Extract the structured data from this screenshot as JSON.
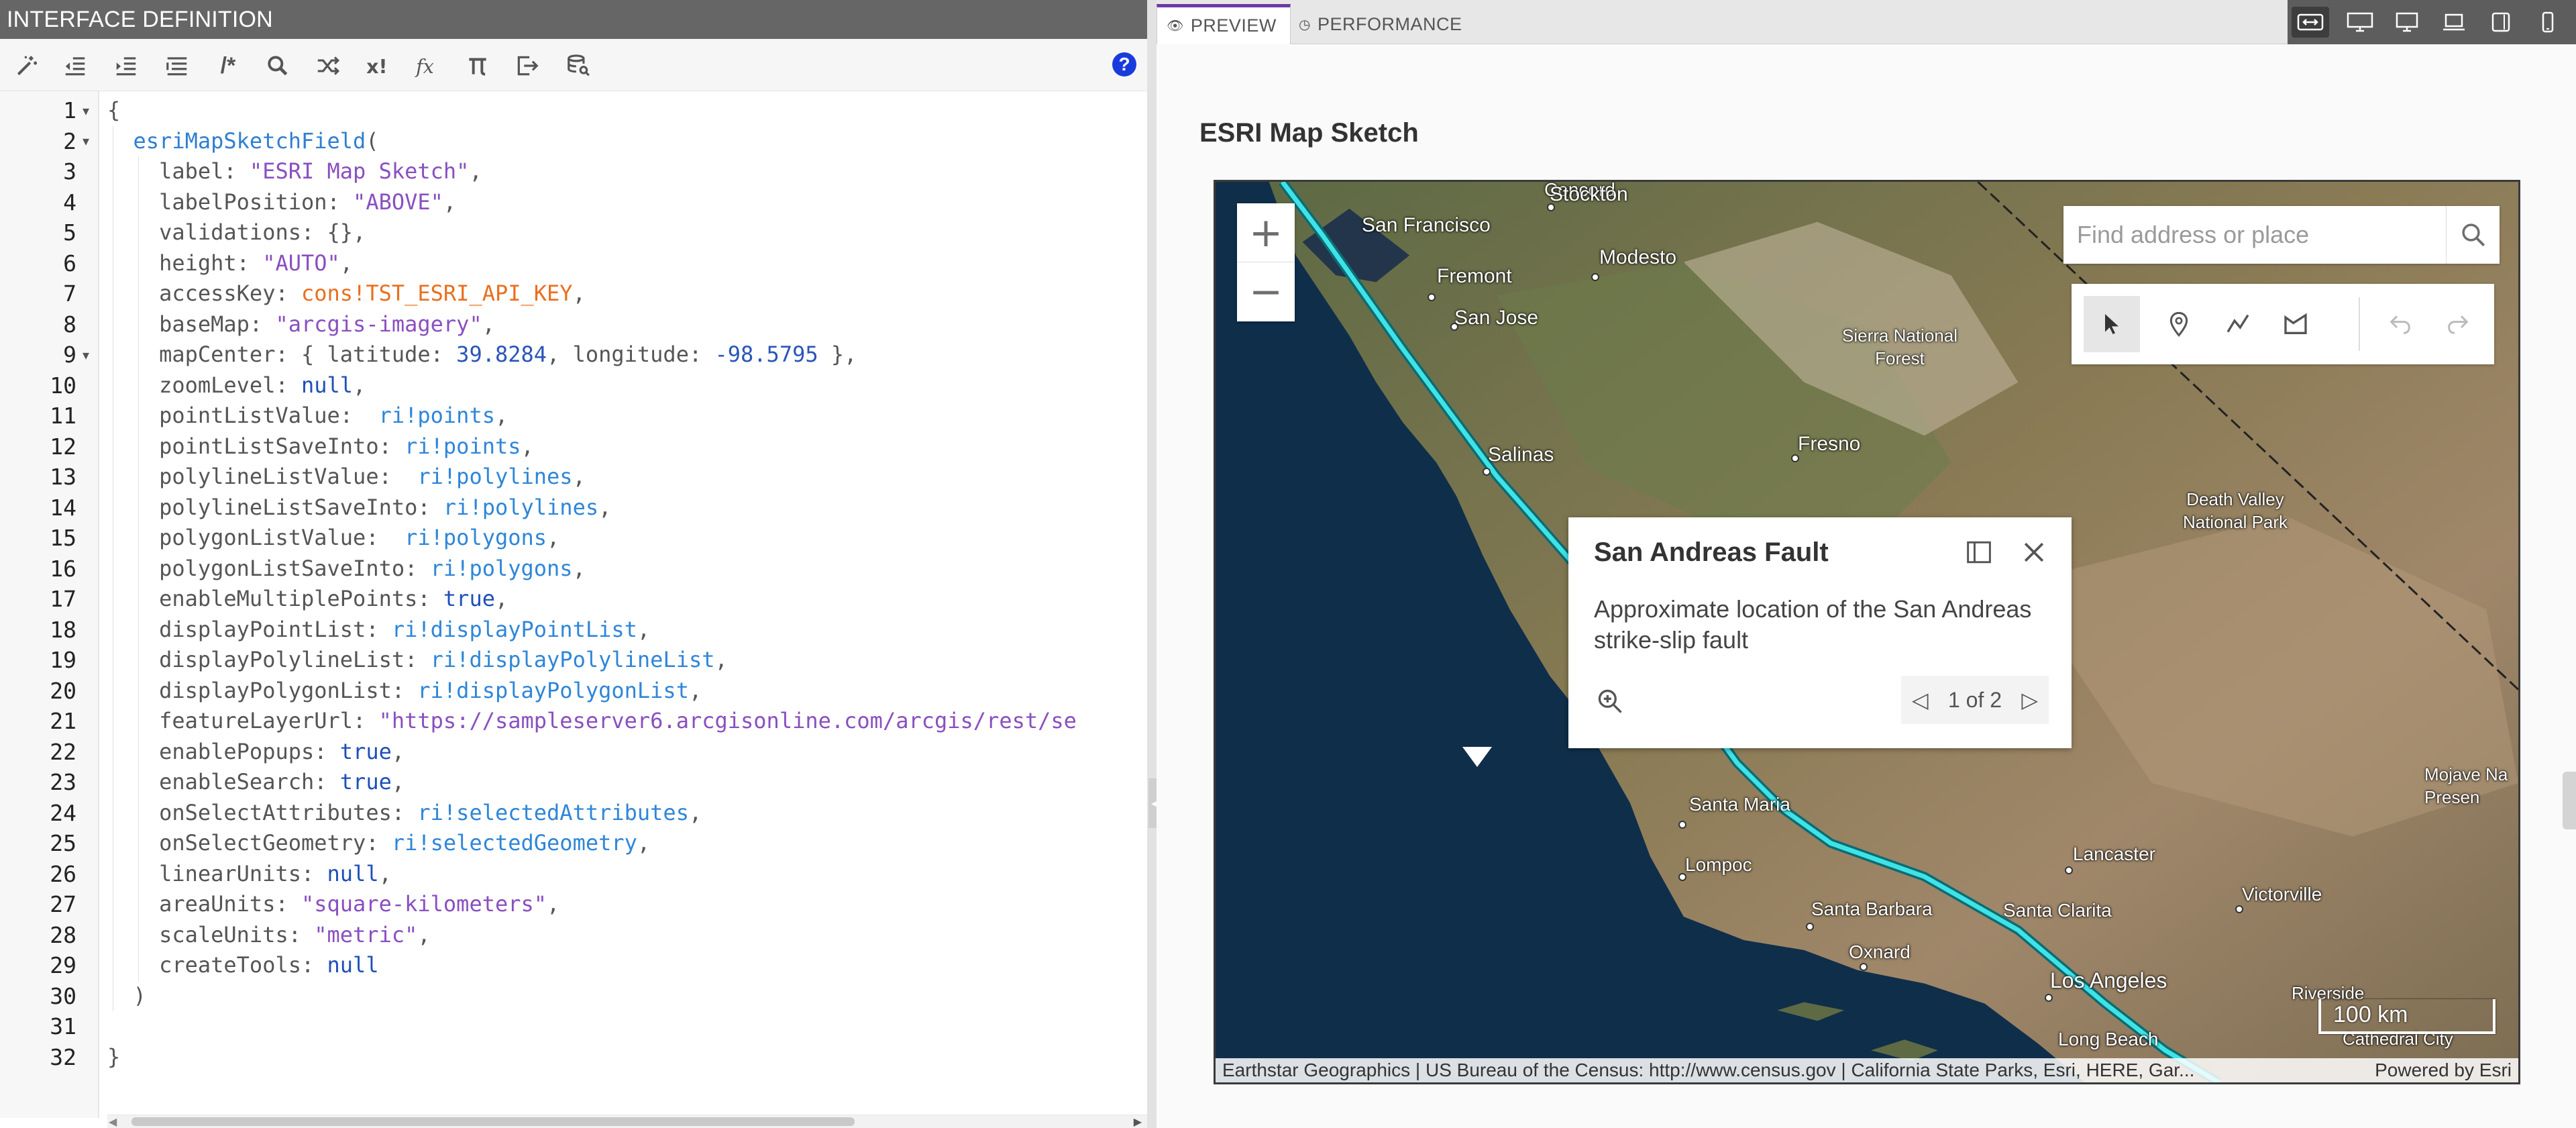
{
  "editor": {
    "header_title": "INTERFACE DEFINITION",
    "toolbar": {
      "comment_label": "/*",
      "help_label": "?"
    },
    "lines": [
      {
        "n": "1",
        "fold": true
      },
      {
        "n": "2",
        "fold": true
      },
      {
        "n": "3"
      },
      {
        "n": "4"
      },
      {
        "n": "5"
      },
      {
        "n": "6"
      },
      {
        "n": "7"
      },
      {
        "n": "8"
      },
      {
        "n": "9",
        "fold": true
      },
      {
        "n": "10"
      },
      {
        "n": "11"
      },
      {
        "n": "12"
      },
      {
        "n": "13"
      },
      {
        "n": "14"
      },
      {
        "n": "15"
      },
      {
        "n": "16"
      },
      {
        "n": "17"
      },
      {
        "n": "18"
      },
      {
        "n": "19"
      },
      {
        "n": "20"
      },
      {
        "n": "21"
      },
      {
        "n": "22"
      },
      {
        "n": "23"
      },
      {
        "n": "24"
      },
      {
        "n": "25"
      },
      {
        "n": "26"
      },
      {
        "n": "27"
      },
      {
        "n": "28"
      },
      {
        "n": "29"
      },
      {
        "n": "30"
      },
      {
        "n": "31"
      },
      {
        "n": "32"
      }
    ],
    "code": [
      [
        [
          "pun",
          "{"
        ]
      ],
      [
        [
          "pun",
          "  "
        ],
        [
          "fn",
          "esriMapSketchField"
        ],
        [
          "pun",
          "("
        ]
      ],
      [
        [
          "pun",
          "    "
        ],
        [
          "k",
          "label: "
        ],
        [
          "str",
          "\"ESRI Map Sketch\""
        ],
        [
          "pun",
          ","
        ]
      ],
      [
        [
          "pun",
          "    "
        ],
        [
          "k",
          "labelPosition: "
        ],
        [
          "str",
          "\"ABOVE\""
        ],
        [
          "pun",
          ","
        ]
      ],
      [
        [
          "pun",
          "    "
        ],
        [
          "k",
          "validations: {},"
        ]
      ],
      [
        [
          "pun",
          "    "
        ],
        [
          "k",
          "height: "
        ],
        [
          "str",
          "\"AUTO\""
        ],
        [
          "pun",
          ","
        ]
      ],
      [
        [
          "pun",
          "    "
        ],
        [
          "k",
          "accessKey: "
        ],
        [
          "cons",
          "cons!TST_ESRI_API_KEY"
        ],
        [
          "pun",
          ","
        ]
      ],
      [
        [
          "pun",
          "    "
        ],
        [
          "k",
          "baseMap: "
        ],
        [
          "str",
          "\"arcgis-imagery\""
        ],
        [
          "pun",
          ","
        ]
      ],
      [
        [
          "pun",
          "    "
        ],
        [
          "k",
          "mapCenter: { latitude: "
        ],
        [
          "num",
          "39.8284"
        ],
        [
          "k",
          ", longitude: "
        ],
        [
          "num",
          "-98.5795"
        ],
        [
          "k",
          " },"
        ]
      ],
      [
        [
          "pun",
          "    "
        ],
        [
          "k",
          "zoomLevel: "
        ],
        [
          "lit",
          "null"
        ],
        [
          "pun",
          ","
        ]
      ],
      [
        [
          "pun",
          "    "
        ],
        [
          "k",
          "pointListValue:  "
        ],
        [
          "ri",
          "ri!points"
        ],
        [
          "pun",
          ","
        ]
      ],
      [
        [
          "pun",
          "    "
        ],
        [
          "k",
          "pointListSaveInto: "
        ],
        [
          "ri",
          "ri!points"
        ],
        [
          "pun",
          ","
        ]
      ],
      [
        [
          "pun",
          "    "
        ],
        [
          "k",
          "polylineListValue:  "
        ],
        [
          "ri",
          "ri!polylines"
        ],
        [
          "pun",
          ","
        ]
      ],
      [
        [
          "pun",
          "    "
        ],
        [
          "k",
          "polylineListSaveInto: "
        ],
        [
          "ri",
          "ri!polylines"
        ],
        [
          "pun",
          ","
        ]
      ],
      [
        [
          "pun",
          "    "
        ],
        [
          "k",
          "polygonListValue:  "
        ],
        [
          "ri",
          "ri!polygons"
        ],
        [
          "pun",
          ","
        ]
      ],
      [
        [
          "pun",
          "    "
        ],
        [
          "k",
          "polygonListSaveInto: "
        ],
        [
          "ri",
          "ri!polygons"
        ],
        [
          "pun",
          ","
        ]
      ],
      [
        [
          "pun",
          "    "
        ],
        [
          "k",
          "enableMultiplePoints: "
        ],
        [
          "lit",
          "true"
        ],
        [
          "pun",
          ","
        ]
      ],
      [
        [
          "pun",
          "    "
        ],
        [
          "k",
          "displayPointList: "
        ],
        [
          "ri",
          "ri!displayPointList"
        ],
        [
          "pun",
          ","
        ]
      ],
      [
        [
          "pun",
          "    "
        ],
        [
          "k",
          "displayPolylineList: "
        ],
        [
          "ri",
          "ri!displayPolylineList"
        ],
        [
          "pun",
          ","
        ]
      ],
      [
        [
          "pun",
          "    "
        ],
        [
          "k",
          "displayPolygonList: "
        ],
        [
          "ri",
          "ri!displayPolygonList"
        ],
        [
          "pun",
          ","
        ]
      ],
      [
        [
          "pun",
          "    "
        ],
        [
          "k",
          "featureLayerUrl: "
        ],
        [
          "str",
          "\"https://sampleserver6.arcgisonline.com/arcgis/rest/se"
        ]
      ],
      [
        [
          "pun",
          "    "
        ],
        [
          "k",
          "enablePopups: "
        ],
        [
          "lit",
          "true"
        ],
        [
          "pun",
          ","
        ]
      ],
      [
        [
          "pun",
          "    "
        ],
        [
          "k",
          "enableSearch: "
        ],
        [
          "lit",
          "true"
        ],
        [
          "pun",
          ","
        ]
      ],
      [
        [
          "pun",
          "    "
        ],
        [
          "k",
          "onSelectAttributes: "
        ],
        [
          "ri",
          "ri!selectedAttributes"
        ],
        [
          "pun",
          ","
        ]
      ],
      [
        [
          "pun",
          "    "
        ],
        [
          "k",
          "onSelectGeometry: "
        ],
        [
          "ri",
          "ri!selectedGeometry"
        ],
        [
          "pun",
          ","
        ]
      ],
      [
        [
          "pun",
          "    "
        ],
        [
          "k",
          "linearUnits: "
        ],
        [
          "lit",
          "null"
        ],
        [
          "pun",
          ","
        ]
      ],
      [
        [
          "pun",
          "    "
        ],
        [
          "k",
          "areaUnits: "
        ],
        [
          "str",
          "\"square-kilometers\""
        ],
        [
          "pun",
          ","
        ]
      ],
      [
        [
          "pun",
          "    "
        ],
        [
          "k",
          "scaleUnits: "
        ],
        [
          "str",
          "\"metric\""
        ],
        [
          "pun",
          ","
        ]
      ],
      [
        [
          "pun",
          "    "
        ],
        [
          "k",
          "createTools: "
        ],
        [
          "lit",
          "null"
        ]
      ],
      [
        [
          "pun",
          "  )"
        ]
      ],
      [
        [
          "pun",
          ""
        ]
      ],
      [
        [
          "pun",
          "}"
        ]
      ]
    ]
  },
  "preview": {
    "tabs": [
      {
        "label": "PREVIEW",
        "icon": "eye-icon",
        "active": true
      },
      {
        "label": "PERFORMANCE",
        "icon": "clock-icon",
        "active": false
      }
    ],
    "title": "ESRI Map Sketch",
    "map": {
      "search_placeholder": "Find address or place",
      "zoom_in": "+",
      "zoom_out": "−",
      "popup": {
        "title": "San Andreas Fault",
        "body": "Approximate location of the San Andreas strike-slip fault",
        "pager": "1 of 2"
      },
      "places": [
        "Stockton",
        "San Francisco",
        "Modesto",
        "Fremont",
        "San Jose",
        "Sierra National Forest",
        "Fresno",
        "Salinas",
        "Death Valley National Park",
        "Mojave Na Presen",
        "Santa Maria",
        "Lompoc",
        "Lancaster",
        "Victorville",
        "Santa Barbara",
        "Santa Clarita",
        "Oxnard",
        "Los Angeles",
        "Riverside",
        "Long Beach",
        "Cathedral City",
        "Concord"
      ],
      "scale": "100 km",
      "attribution": "Earthstar Geographics | US Bureau of the Census: http://www.census.gov | California State Parks, Esri, HERE, Gar...",
      "powered_by": "Powered by Esri"
    }
  },
  "colors": {
    "fault_line": "#3fe3e6",
    "accent_tab": "#6b3aa8",
    "help_icon": "#1a3bdc"
  }
}
